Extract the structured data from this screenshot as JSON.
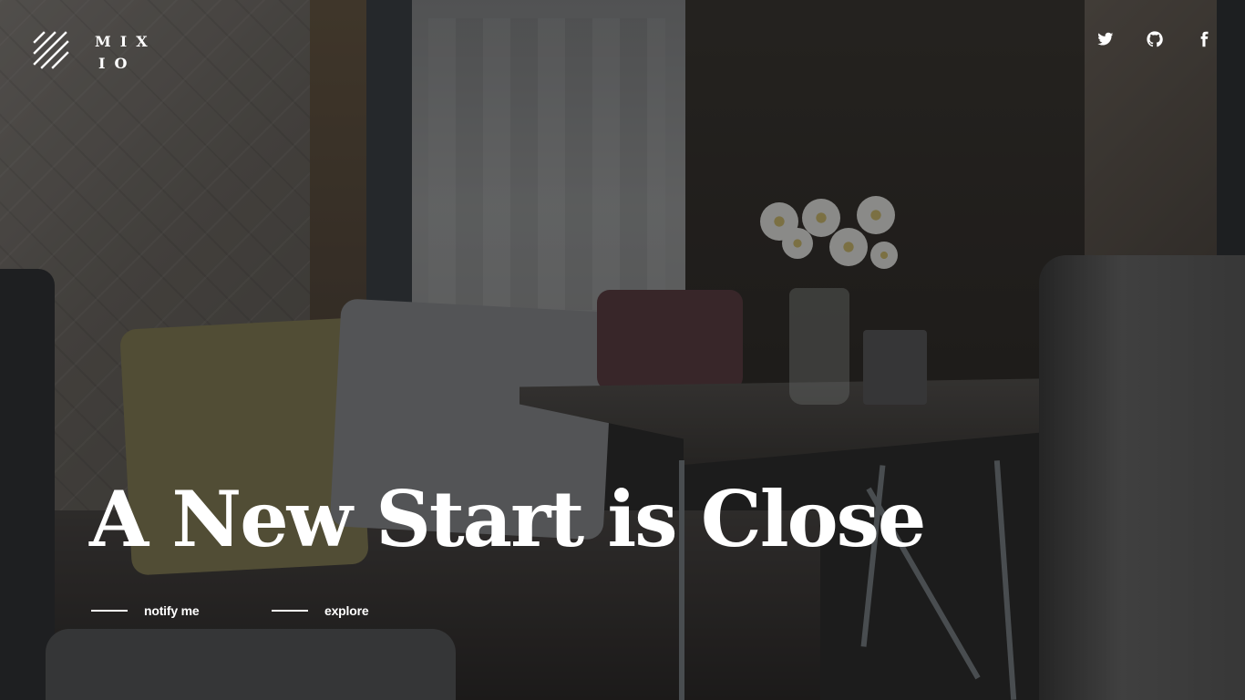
{
  "brand": {
    "logo_line1": "MIX",
    "logo_line2": "IO",
    "logo_icon": "diagonal-stripes-logo-mark"
  },
  "social": [
    {
      "icon": "twitter-icon",
      "label": "Twitter"
    },
    {
      "icon": "github-icon",
      "label": "GitHub"
    },
    {
      "icon": "facebook-icon",
      "label": "Facebook"
    }
  ],
  "hero": {
    "title": "A New Start is Close"
  },
  "actions": {
    "notify_label": "notify me",
    "explore_label": "explore"
  },
  "colors": {
    "text": "#ffffff",
    "overlay": "#0a0a0a"
  }
}
